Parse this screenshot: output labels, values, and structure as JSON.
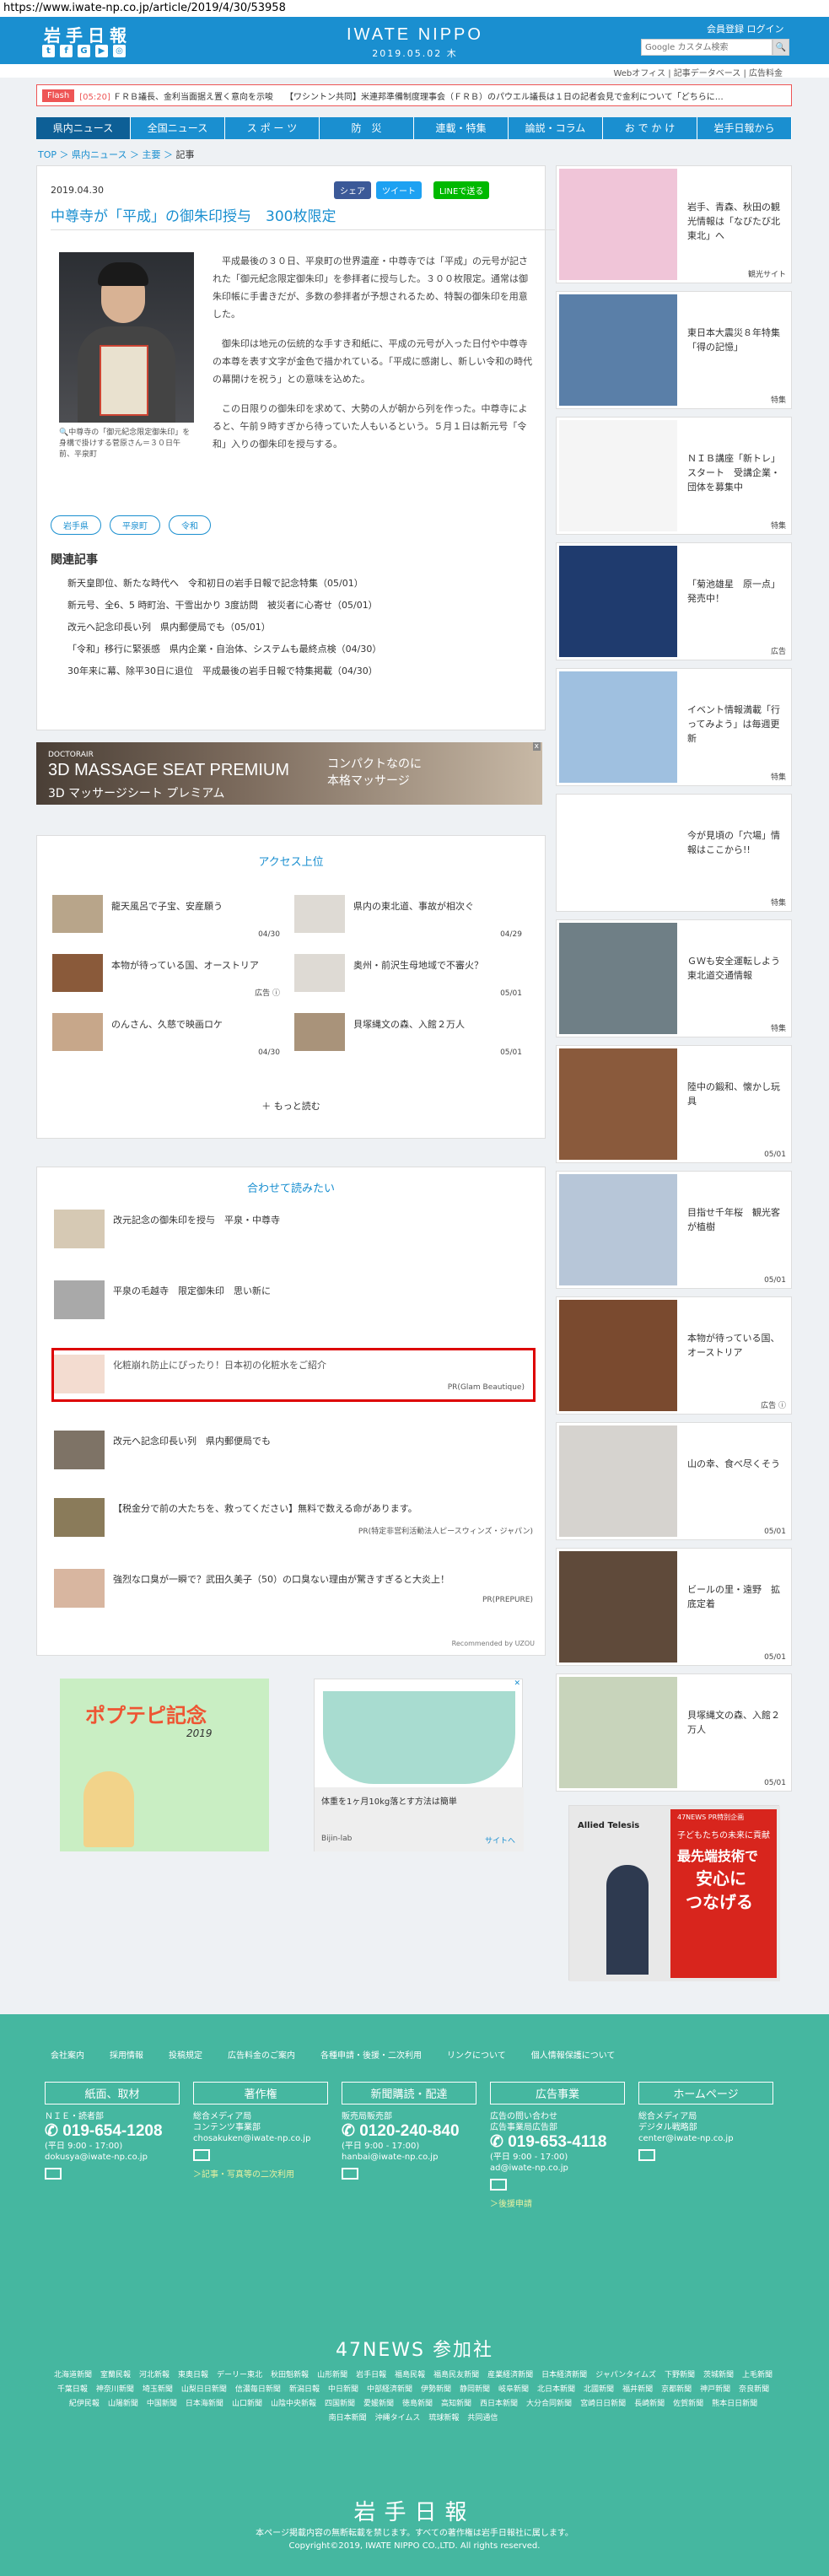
{
  "url": "https://www.iwate-np.co.jp/article/2019/4/30/53958",
  "header": {
    "logo": "岩手日報",
    "brand": "IWATE NIPPO",
    "date": "2019.05.02  木",
    "member_links": "会員登録  ログイン",
    "search_placeholder": "Google カスタム検索",
    "social": [
      "t",
      "f",
      "G",
      "▶",
      "◎"
    ]
  },
  "subnav": "Webオフィス  |  記事データベース  |  広告料金",
  "ticker": {
    "badge": "Flash",
    "items": [
      {
        "time": "[05:20]",
        "text": "ＦＲＢ議長、金利当面据え置く意向を示唆"
      },
      {
        "time": "",
        "text": "【ワシントン共同】米連邦準備制度理事会（ＦＲＢ）のパウエル議長は１日の記者会見で金利について「どちらに…"
      }
    ]
  },
  "gnav": [
    "県内ニュース",
    "全国ニュース",
    "ス ポ ー ツ",
    "防　災",
    "連載・特集",
    "論説・コラム",
    "お で か け",
    "岩手日報から"
  ],
  "breadcrumb": {
    "top": "TOP",
    "l1": "県内ニュース",
    "l2": "主要",
    "cur": "記事"
  },
  "article": {
    "date": "2019.04.30",
    "share": {
      "fb": "シェア",
      "tw": "ツイート",
      "line": "LINEで送る"
    },
    "title": "中尊寺が「平成」の御朱印授与　300枚限定",
    "caption": "中尊寺の「御元紀念限定御朱印」を身構で掛けする菅原さん＝３０日午前、平泉町",
    "paragraphs": [
      "平成最後の３０日、平泉町の世界遺産・中尊寺では「平成」の元号が記された「御元紀念限定御朱印」を参拝者に授与した。３００枚限定。通常は御朱印帳に手書きだが、多数の参拝者が予想されるため、特製の御朱印を用意した。",
      "御朱印は地元の伝統的な手すき和紙に、平成の元号が入った日付や中尊寺の本尊を表す文字が金色で描かれている。「平成に感謝し、新しい令和の時代の幕開けを祝う」との意味を込めた。",
      "この日限りの御朱印を求めて、大勢の人が朝から列を作った。中尊寺によると、午前９時すぎから待っていた人もいるという。５月１日は新元号「令和」入りの御朱印を授与する。"
    ],
    "tags": [
      "岩手県",
      "平泉町",
      "令和"
    ],
    "related_heading": "関連記事",
    "related": [
      "新天皇即位、新たな時代へ　令和初日の岩手日報で記念特集（05/01）",
      "新元号、全6、5 時町治、干雪出かり 3度訪問　被災者に心寄せ（05/01）",
      "改元へ記念印長い列　県内郵便局でも（05/01）",
      "「令和」移行に緊張感　県内企業・自治体、システムも最終点検（04/30）",
      "30年来に幕、除平30日に退位　平成最後の岩手日報で特集掲載（04/30）"
    ]
  },
  "ad_banner": {
    "brand": "DOCTORAIR",
    "line1": "3D MASSAGE SEAT PREMIUM",
    "line2": "3D マッサージシート プレミアム",
    "copy1": "コンパクトなのに",
    "copy2": "本格マッサージ",
    "close": "x"
  },
  "access": {
    "heading": "アクセス上位",
    "items": [
      {
        "text": "龍天風呂で子宝、安産願う",
        "date": "04/30"
      },
      {
        "text": "県内の東北道、事故が相次ぐ",
        "date": "04/29"
      },
      {
        "text": "本物が待っている国、オーストリア",
        "date": "広告 ⓘ"
      },
      {
        "text": "奥州・前沢生母地域で不審火？",
        "date": "05/01"
      },
      {
        "text": "のんさん、久慈で映画ロケ",
        "date": "04/30"
      },
      {
        "text": "貝塚縄文の森、入館２万人",
        "date": "05/01"
      }
    ],
    "more": "＋ もっと読む"
  },
  "recommend": {
    "heading": "合わせて読みたい",
    "items": [
      {
        "text": "改元記念の御朱印を授与　平泉・中尊寺",
        "pr": ""
      },
      {
        "text": "平泉の毛越寺　限定御朱印　思い新に",
        "pr": ""
      },
      {
        "text": "化粧崩れ防止にぴったり！日本初の化粧水をご紹介",
        "pr": "PR(Glam Beautique)"
      },
      {
        "text": "改元へ記念印長い列　県内郵便局でも",
        "pr": ""
      },
      {
        "text": "【税金分で前の大たちを、救ってください】無料で数える命があります。",
        "pr": "PR(特定非営利活動法人ピースウィンズ・ジャパン)"
      },
      {
        "text": "強烈な口臭が一瞬で？武田久美子（50）の口臭ない理由が驚きすぎると大炎上！",
        "pr": "PR(PREPURE)"
      }
    ],
    "footer": "Recommended by UZOU"
  },
  "bottom_ads": {
    "left_title": "ポプテピ記念",
    "left_sub": "2019",
    "right_text": "体重を1ヶ月10kg落とす方法は簡単",
    "right_src": "Bijin-lab",
    "right_link": "サイトへ"
  },
  "sidebar": [
    {
      "text": "岩手、青森、秋田の観光情報は「なびたび北東北」へ",
      "cat": "観光サイト",
      "color": "#f0c5d8"
    },
    {
      "text": "東日本大震災８年特集「得の記憶」",
      "cat": "特集",
      "color": "#5a7fa8"
    },
    {
      "text": "ＮＩＢ講座「新トレ」スタート　受講企業・団体を募集中",
      "cat": "特集",
      "color": "#f5f5f5"
    },
    {
      "text": "「菊池雄星　原一点」発売中！",
      "cat": "広告",
      "color": "#1f3b6e"
    },
    {
      "text": "イベント情報満載「行ってみよう」は毎週更新",
      "cat": "特集",
      "color": "#9fc0e0"
    },
    {
      "text": "今が見頃の「穴場」情報はここから!!",
      "cat": "特集",
      "color": "#ffffff"
    },
    {
      "text": "ＧＷも安全運転しよう　東北道交通情報",
      "cat": "特集",
      "color": "#6f7f86"
    },
    {
      "text": "陸中の鍛和、懐かし玩具",
      "cat": "05/01",
      "color": "#8a5a3c"
    },
    {
      "text": "目指せ千年桜　観光客が植樹",
      "cat": "05/01",
      "color": "#b7c6d8"
    },
    {
      "text": "本物が待っている国、オーストリア",
      "cat": "広告 ⓘ",
      "color": "#7a4a2f"
    },
    {
      "text": "山の幸、食べ尽くそう",
      "cat": "05/01",
      "color": "#d6d3cf"
    },
    {
      "text": "ビールの里・遠野　拡底定着",
      "cat": "05/01",
      "color": "#5f4a3a"
    },
    {
      "text": "貝塚縄文の森、入館２万人",
      "cat": "05/01",
      "color": "#c8d4bb"
    }
  ],
  "side_ad": {
    "brand": "Allied Telesis",
    "label": "47NEWS PR特別企画",
    "l1": "子どもたちの未来に貢献",
    "l2": "最先端技術で",
    "l3": "安心に",
    "l4": "つなげる"
  },
  "footer": {
    "links": [
      "会社案内",
      "採用情報",
      "投稿規定",
      "広告料金のご案内",
      "各種申請・後援・二次利用",
      "リンクについて",
      "個人情報保護について"
    ],
    "columns": [
      {
        "title": "紙面、取材",
        "l1": "ＮＩＥ・読者部",
        "phone": "019-654-1208",
        "hours": "(平日 9:00 - 17:00)",
        "mail": "dokusya@iwate-np.co.jp",
        "extra": ""
      },
      {
        "title": "著作権",
        "l1": "総合メディア局\nコンテンツ事業部",
        "phone": "",
        "hours": "",
        "mail": "chosakuken@iwate-np.co.jp",
        "extra": "＞記事・写真等の二次利用"
      },
      {
        "title": "新聞購読・配達",
        "l1": "販売局販売部",
        "phone": "0120-240-840",
        "hours": "(平日 9:00 - 17:00)",
        "mail": "hanbai@iwate-np.co.jp",
        "extra": ""
      },
      {
        "title": "広告事業",
        "l1": "広告の問い合わせ\n広告事業局広告部",
        "phone": "019-653-4118",
        "hours": "(平日 9:00 - 17:00)",
        "mail": "ad@iwate-np.co.jp",
        "extra": "＞後援申請"
      },
      {
        "title": "ホームページ",
        "l1": "総合メディア局\nデジタル戦略部",
        "phone": "",
        "hours": "",
        "mail": "center@iwate-np.co.jp",
        "extra": ""
      }
    ],
    "news47": "47NEWS 参加社",
    "papers": [
      "北海道新聞",
      "室蘭民報",
      "河北新報",
      "東奥日報",
      "デーリー東北",
      "秋田魁新報",
      "山形新聞",
      "岩手日報",
      "福島民報",
      "福島民友新聞",
      "産業経済新聞",
      "日本経済新聞",
      "ジャパンタイムズ",
      "下野新聞",
      "茨城新聞",
      "上毛新聞",
      "千葉日報",
      "神奈川新聞",
      "埼玉新聞",
      "山梨日日新聞",
      "信濃毎日新聞",
      "新潟日報",
      "中日新聞",
      "中部経済新聞",
      "伊勢新聞",
      "静岡新聞",
      "岐阜新聞",
      "北日本新聞",
      "北國新聞",
      "福井新聞",
      "京都新聞",
      "神戸新聞",
      "奈良新聞",
      "紀伊民報",
      "山陽新聞",
      "中国新聞",
      "日本海新聞",
      "山口新聞",
      "山陰中央新報",
      "四国新聞",
      "愛媛新聞",
      "徳島新聞",
      "高知新聞",
      "西日本新聞",
      "大分合同新聞",
      "宮崎日日新聞",
      "長崎新聞",
      "佐賀新聞",
      "熊本日日新聞",
      "南日本新聞",
      "沖縄タイムス",
      "琉球新報",
      "共同通信"
    ],
    "logo": "岩手日報",
    "note1": "本ページ掲載内容の無断転載を禁じます。すべての著作権は岩手日報社に属します。",
    "note2": "Copyright©2019, IWATE NIPPO CO.,LTD. All rights reserved."
  }
}
